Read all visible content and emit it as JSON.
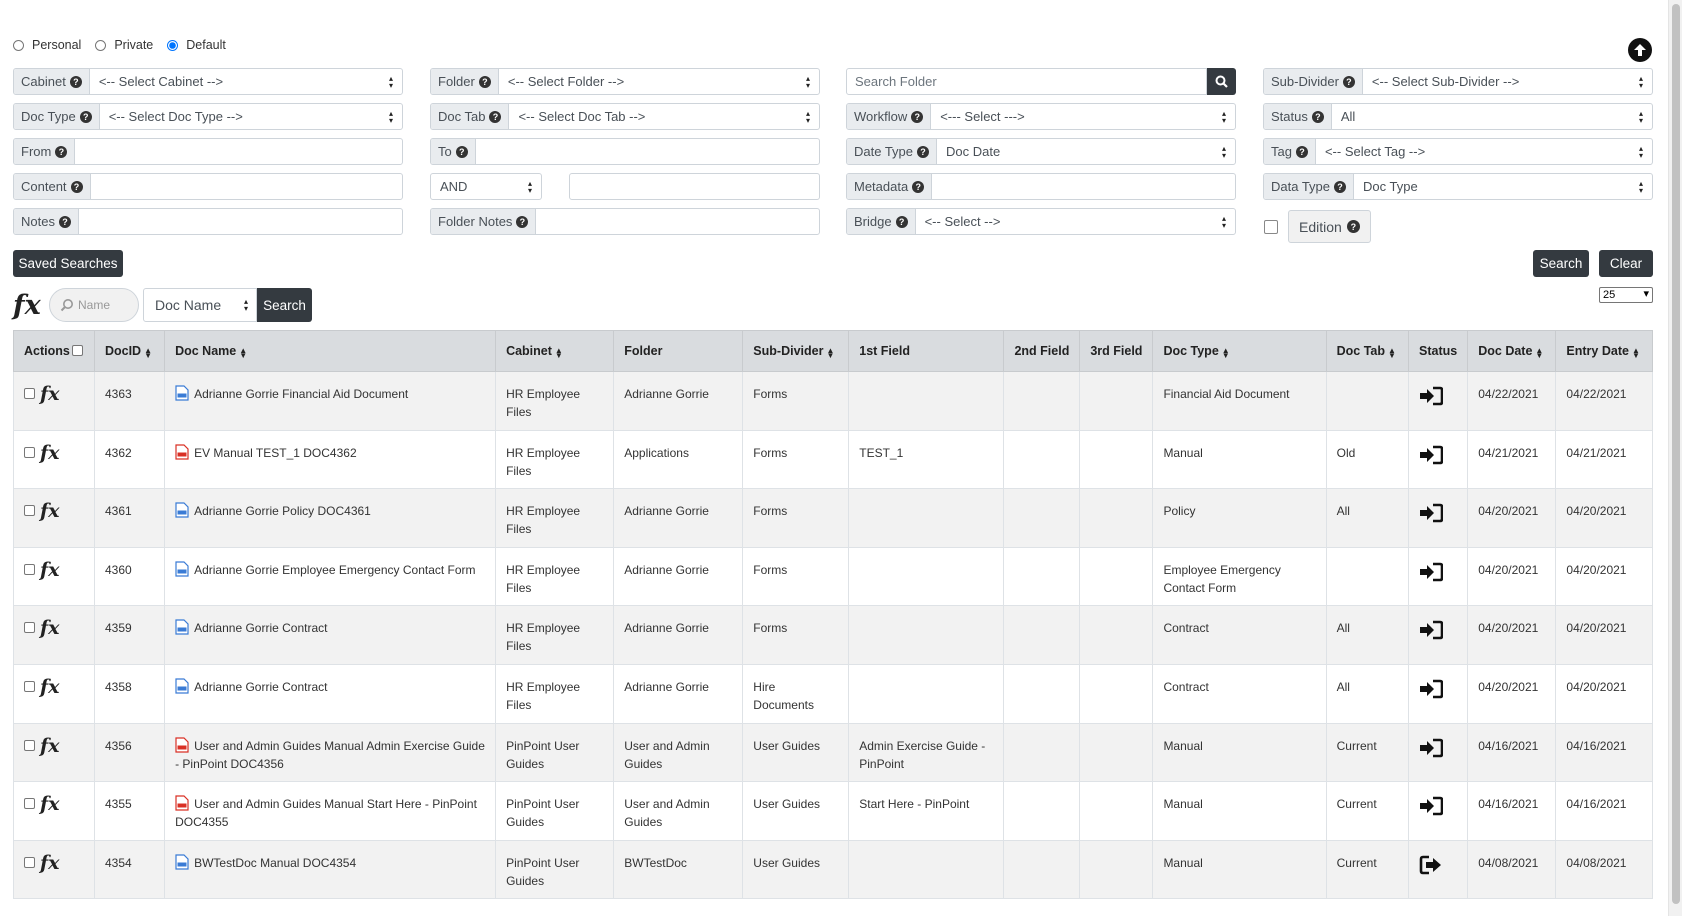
{
  "scope": {
    "options": [
      "Personal",
      "Private",
      "Default"
    ],
    "selected": "Default"
  },
  "filters": {
    "cabinet": {
      "label": "Cabinet",
      "value": "<-- Select Cabinet -->"
    },
    "folder": {
      "label": "Folder",
      "value": "<-- Select Folder -->"
    },
    "search_folder": {
      "placeholder": "Search Folder"
    },
    "sub_divider": {
      "label": "Sub-Divider",
      "value": "<-- Select Sub-Divider -->"
    },
    "doc_type": {
      "label": "Doc Type",
      "value": "<-- Select Doc Type -->"
    },
    "doc_tab": {
      "label": "Doc Tab",
      "value": "<-- Select Doc Tab -->"
    },
    "workflow": {
      "label": "Workflow",
      "value": "<--- Select --->"
    },
    "status": {
      "label": "Status",
      "value": "All"
    },
    "from": {
      "label": "From",
      "value": ""
    },
    "to": {
      "label": "To",
      "value": ""
    },
    "date_type": {
      "label": "Date Type",
      "value": "Doc Date"
    },
    "tag": {
      "label": "Tag",
      "value": "<-- Select Tag -->"
    },
    "content": {
      "label": "Content",
      "value": ""
    },
    "operator": {
      "value": "AND"
    },
    "content2": {
      "value": ""
    },
    "metadata": {
      "label": "Metadata",
      "value": ""
    },
    "data_type": {
      "label": "Data Type",
      "value": "Doc Type"
    },
    "notes": {
      "label": "Notes",
      "value": ""
    },
    "folder_notes": {
      "label": "Folder Notes",
      "value": ""
    },
    "bridge": {
      "label": "Bridge",
      "value": "<-- Select -->"
    },
    "edition": {
      "label": "Edition"
    }
  },
  "buttons": {
    "saved_searches": "Saved Searches",
    "search": "Search",
    "clear": "Clear"
  },
  "fx_bar": {
    "logo": "fx",
    "name_placeholder": "Name",
    "field_select": "Doc Name",
    "search": "Search"
  },
  "page_size": "25",
  "table": {
    "headers": {
      "actions": "Actions",
      "docid": "DocID",
      "docname": "Doc Name",
      "cabinet": "Cabinet",
      "folder": "Folder",
      "subdivider": "Sub-Divider",
      "field1": "1st Field",
      "field2": "2nd Field",
      "field3": "3rd Field",
      "doctype": "Doc Type",
      "doctab": "Doc Tab",
      "status": "Status",
      "docdate": "Doc Date",
      "entrydate": "Entry Date"
    },
    "rows": [
      {
        "docid": "4363",
        "file": "doc",
        "docname": "Adrianne Gorrie Financial Aid Document",
        "cabinet": "HR Employee Files",
        "folder": "Adrianne Gorrie",
        "subdivider": "Forms",
        "field1": "",
        "field2": "",
        "field3": "",
        "doctype": "Financial Aid Document",
        "doctab": "",
        "status_icon": "sign-in-icon",
        "docdate": "04/22/2021",
        "entrydate": "04/22/2021"
      },
      {
        "docid": "4362",
        "file": "pdf",
        "docname": "EV Manual TEST_1 DOC4362",
        "cabinet": "HR Employee Files",
        "folder": "Applications",
        "subdivider": "Forms",
        "field1": "TEST_1",
        "field2": "",
        "field3": "",
        "doctype": "Manual",
        "doctab": "Old",
        "status_icon": "sign-in-icon",
        "docdate": "04/21/2021",
        "entrydate": "04/21/2021"
      },
      {
        "docid": "4361",
        "file": "doc",
        "docname": "Adrianne Gorrie Policy DOC4361",
        "cabinet": "HR Employee Files",
        "folder": "Adrianne Gorrie",
        "subdivider": "Forms",
        "field1": "",
        "field2": "",
        "field3": "",
        "doctype": "Policy",
        "doctab": "All",
        "status_icon": "sign-in-icon",
        "docdate": "04/20/2021",
        "entrydate": "04/20/2021"
      },
      {
        "docid": "4360",
        "file": "doc",
        "docname": "Adrianne Gorrie Employee Emergency Contact Form",
        "cabinet": "HR Employee Files",
        "folder": "Adrianne Gorrie",
        "subdivider": "Forms",
        "field1": "",
        "field2": "",
        "field3": "",
        "doctype": "Employee Emergency Contact Form",
        "doctab": "",
        "status_icon": "sign-in-icon",
        "docdate": "04/20/2021",
        "entrydate": "04/20/2021"
      },
      {
        "docid": "4359",
        "file": "doc",
        "docname": "Adrianne Gorrie Contract",
        "cabinet": "HR Employee Files",
        "folder": "Adrianne Gorrie",
        "subdivider": "Forms",
        "field1": "",
        "field2": "",
        "field3": "",
        "doctype": "Contract",
        "doctab": "All",
        "status_icon": "sign-in-icon",
        "docdate": "04/20/2021",
        "entrydate": "04/20/2021"
      },
      {
        "docid": "4358",
        "file": "doc",
        "docname": "Adrianne Gorrie Contract",
        "cabinet": "HR Employee Files",
        "folder": "Adrianne Gorrie",
        "subdivider": "Hire Documents",
        "field1": "",
        "field2": "",
        "field3": "",
        "doctype": "Contract",
        "doctab": "All",
        "status_icon": "sign-in-icon",
        "docdate": "04/20/2021",
        "entrydate": "04/20/2021"
      },
      {
        "docid": "4356",
        "file": "pdf",
        "docname": "User and Admin Guides Manual Admin Exercise Guide - PinPoint DOC4356",
        "cabinet": "PinPoint User Guides",
        "folder": "User and Admin Guides",
        "subdivider": "User Guides",
        "field1": "Admin Exercise Guide - PinPoint",
        "field2": "",
        "field3": "",
        "doctype": "Manual",
        "doctab": "Current",
        "status_icon": "sign-in-icon",
        "docdate": "04/16/2021",
        "entrydate": "04/16/2021"
      },
      {
        "docid": "4355",
        "file": "pdf",
        "docname": "User and Admin Guides Manual Start Here - PinPoint DOC4355",
        "cabinet": "PinPoint User Guides",
        "folder": "User and Admin Guides",
        "subdivider": "User Guides",
        "field1": "Start Here - PinPoint",
        "field2": "",
        "field3": "",
        "doctype": "Manual",
        "doctab": "Current",
        "status_icon": "sign-in-icon",
        "docdate": "04/16/2021",
        "entrydate": "04/16/2021"
      },
      {
        "docid": "4354",
        "file": "doc",
        "docname": "BWTestDoc Manual DOC4354",
        "cabinet": "PinPoint User Guides",
        "folder": "BWTestDoc",
        "subdivider": "User Guides",
        "field1": "",
        "field2": "",
        "field3": "",
        "doctype": "Manual",
        "doctab": "Current",
        "status_icon": "sign-out-icon",
        "docdate": "04/08/2021",
        "entrydate": "04/08/2021"
      }
    ]
  }
}
